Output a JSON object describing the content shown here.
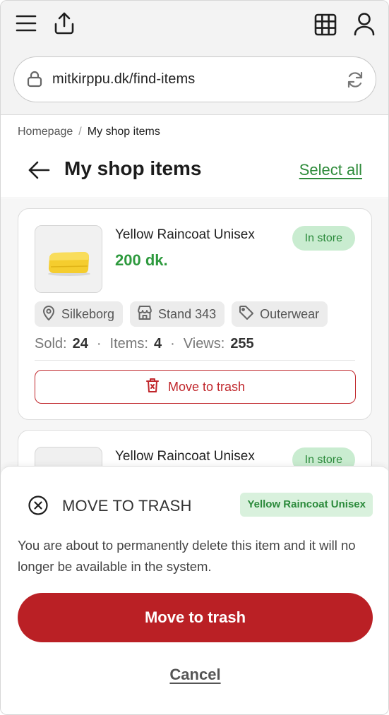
{
  "browser": {
    "url": "mitkirppu.dk/find-items"
  },
  "breadcrumb": {
    "home": "Homepage",
    "separator": "/",
    "current": "My shop items"
  },
  "header": {
    "title": "My shop items",
    "select_all": "Select all"
  },
  "items": [
    {
      "title": "Yellow Raincoat Unisex",
      "price": "200 dk.",
      "status": "In store",
      "location": "Silkeborg",
      "stand": "Stand 343",
      "category": "Outerwear",
      "sold_label": "Sold:",
      "sold": "24",
      "items_label": "Items:",
      "items_count": "4",
      "views_label": "Views:",
      "views": "255",
      "trash_label": "Move to trash"
    },
    {
      "title": "Yellow Raincoat Unisex",
      "status": "In store"
    }
  ],
  "dialog": {
    "title": "MOVE TO TRASH",
    "item_badge": "Yellow Raincoat Unisex",
    "message": "You are about to permanently delete this item and it will no longer be available in the system.",
    "confirm_label": "Move to trash",
    "cancel_label": "Cancel"
  },
  "colors": {
    "accent_green": "#2e9a3e",
    "danger_red": "#ba2025",
    "status_bg": "#c9ecd0"
  },
  "icons": [
    "menu-icon",
    "share-icon",
    "grid-icon",
    "user-icon",
    "lock-icon",
    "reload-icon",
    "back-arrow-icon",
    "location-pin-icon",
    "store-icon",
    "tag-icon",
    "trash-icon",
    "close-circle-icon"
  ]
}
